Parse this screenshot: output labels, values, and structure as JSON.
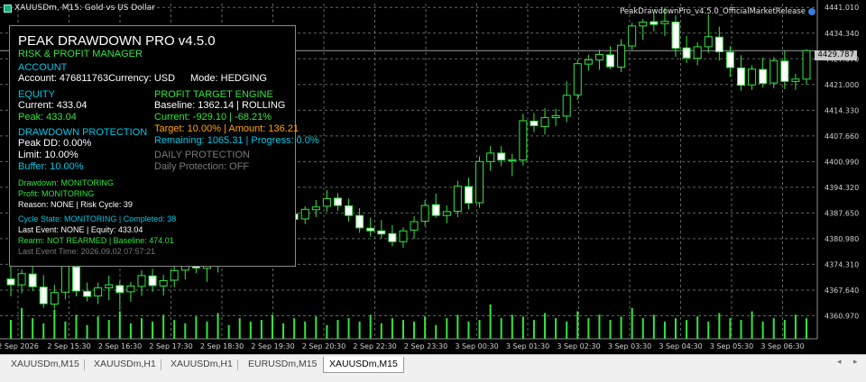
{
  "window": {
    "symbol_title": "XAUUSDm, M15:  Gold vs US Dollar",
    "ea_label": "PeakDrawdownPro_v4.5.0_OfficialMarketRelease"
  },
  "panel": {
    "title": "PEAK DRAWDOWN PRO v4.5.0",
    "subtitle": "RISK & PROFIT MANAGER",
    "account_header": "ACCOUNT",
    "account_line": "Account: 476811763Currency: USD",
    "mode_line": "Mode: HEDGING",
    "equity_header": "EQUITY",
    "equity_current": "Current: 433.04",
    "equity_peak": "Peak: 433.04",
    "profit_header": "PROFIT TARGET ENGINE",
    "profit_baseline": "Baseline: 1362.14 | ROLLING",
    "profit_current": "Current: -929.10 | -68.21%",
    "profit_target": "Target: 10.00% | Amount: 136.21",
    "profit_remaining": "Remaining: 1065.31 | Progress: 0.0%",
    "drawdown_header": "DRAWDOWN PROTECTION",
    "peak_dd": "Peak DD: 0.00%",
    "dd_limit": "Limit: 10.00%",
    "dd_buffer": "Buffer: 10.00%",
    "daily_header": "DAILY PROTECTION",
    "daily_status": "Daily Protection: OFF",
    "status_drawdown": "Drawdown: MONITORING",
    "status_profit": "Profit: MONITORING",
    "status_reason": "Reason: NONE  |  Risk Cycle: 39",
    "cycle_state": "Cycle State: MONITORING | Completed: 38",
    "last_event": "Last Event: NONE | Equity: 433.04",
    "rearm": "Rearm: NOT REARMED | Baseline: 474.01",
    "last_event_time": "Last Event Time: 2026.09.02 07:57:21"
  },
  "price_axis": {
    "labels": [
      "4441.010",
      "4434.340",
      "4427.670",
      "4421.000",
      "4414.330",
      "4407.660",
      "4400.990",
      "4394.320",
      "4387.650",
      "4380.980",
      "4374.310",
      "4367.640",
      "4360.970"
    ],
    "current_price": "4429.787"
  },
  "time_axis": {
    "labels": [
      "2 Sep 2026",
      "2 Sep 15:30",
      "2 Sep 16:30",
      "2 Sep 17:30",
      "2 Sep 18:30",
      "2 Sep 19:30",
      "2 Sep 20:30",
      "2 Sep 22:30",
      "2 Sep 23:30",
      "3 Sep 00:30",
      "3 Sep 01:30",
      "3 Sep 02:30",
      "3 Sep 03:30",
      "3 Sep 04:30",
      "3 Sep 05:30",
      "3 Sep 06:30"
    ]
  },
  "chart_data": {
    "type": "candlestick",
    "symbol": "XAUUSDm",
    "timeframe": "M15",
    "ylim": [
      4355,
      4442
    ],
    "grid": true,
    "candles": [
      [
        4370.5,
        4374.6,
        4366.0,
        4369.0
      ],
      [
        4369.0,
        4373.0,
        4366.8,
        4371.9
      ],
      [
        4371.8,
        4375.0,
        4367.4,
        4368.5
      ],
      [
        4368.4,
        4371.5,
        4363.0,
        4364.1
      ],
      [
        4364.0,
        4369.0,
        4362.8,
        4367.0
      ],
      [
        4367.1,
        4375.6,
        4365.2,
        4373.8
      ],
      [
        4373.6,
        4375.2,
        4366.0,
        4367.4
      ],
      [
        4367.3,
        4369.6,
        4364.7,
        4366.0
      ],
      [
        4366.1,
        4369.6,
        4364.0,
        4368.2
      ],
      [
        4368.2,
        4371.4,
        4365.0,
        4369.0
      ],
      [
        4368.8,
        4370.0,
        4362.4,
        4367.0
      ],
      [
        4367.2,
        4369.8,
        4364.6,
        4368.7
      ],
      [
        4368.6,
        4372.8,
        4366.1,
        4371.4
      ],
      [
        4371.3,
        4373.2,
        4367.2,
        4368.8
      ],
      [
        4368.7,
        4371.6,
        4366.2,
        4370.1
      ],
      [
        4370.2,
        4374.5,
        4368.4,
        4372.7
      ],
      [
        4372.8,
        4376.5,
        4370.4,
        4375.2
      ],
      [
        4375.0,
        4377.7,
        4372.0,
        4373.4
      ],
      [
        4373.3,
        4375.3,
        4369.8,
        4374.0
      ],
      [
        4374.0,
        4378.2,
        4372.2,
        4376.4
      ],
      [
        4376.5,
        4380.0,
        4374.3,
        4378.8
      ],
      [
        4378.7,
        4382.3,
        4376.5,
        4380.6
      ],
      [
        4380.4,
        4384.4,
        4378.0,
        4382.0
      ],
      [
        4381.9,
        4386.0,
        4380.0,
        4384.1
      ],
      [
        4384.0,
        4388.2,
        4382.5,
        4386.2
      ],
      [
        4386.1,
        4390.0,
        4384.0,
        4387.3
      ],
      [
        4387.4,
        4389.5,
        4384.4,
        4386.0
      ],
      [
        4386.1,
        4389.4,
        4384.8,
        4388.6
      ],
      [
        4388.5,
        4391.0,
        4386.6,
        4389.2
      ],
      [
        4389.4,
        4393.6,
        4388.0,
        4391.4
      ],
      [
        4391.5,
        4392.8,
        4388.2,
        4389.6
      ],
      [
        4389.5,
        4391.4,
        4385.4,
        4387.0
      ],
      [
        4387.0,
        4388.9,
        4382.5,
        4383.8
      ],
      [
        4383.7,
        4386.4,
        4381.5,
        4383.0
      ],
      [
        4383.0,
        4385.8,
        4381.0,
        4382.2
      ],
      [
        4382.3,
        4384.5,
        4379.0,
        4380.2
      ],
      [
        4380.2,
        4383.9,
        4378.6,
        4383.0
      ],
      [
        4383.2,
        4386.8,
        4381.0,
        4385.4
      ],
      [
        4385.5,
        4391.0,
        4384.3,
        4389.6
      ],
      [
        4389.8,
        4392.7,
        4386.4,
        4387.0
      ],
      [
        4387.0,
        4389.6,
        4385.0,
        4388.0
      ],
      [
        4388.1,
        4396.0,
        4386.6,
        4394.6
      ],
      [
        4394.5,
        4396.8,
        4388.6,
        4390.2
      ],
      [
        4390.3,
        4402.4,
        4389.0,
        4401.0
      ],
      [
        4401.0,
        4405.0,
        4398.6,
        4403.2
      ],
      [
        4403.2,
        4405.0,
        4399.8,
        4401.4
      ],
      [
        4401.2,
        4403.0,
        4397.2,
        4401.5
      ],
      [
        4401.4,
        4413.4,
        4400.0,
        4411.6
      ],
      [
        4411.5,
        4413.6,
        4408.6,
        4410.3
      ],
      [
        4410.1,
        4414.9,
        4408.0,
        4412.4
      ],
      [
        4412.4,
        4414.7,
        4410.2,
        4412.9
      ],
      [
        4412.8,
        4421.8,
        4411.2,
        4418.2
      ],
      [
        4418.3,
        4427.4,
        4417.0,
        4426.4
      ],
      [
        4426.3,
        4428.7,
        4424.6,
        4427.4
      ],
      [
        4427.4,
        4430.0,
        4424.8,
        4428.8
      ],
      [
        4428.7,
        4430.9,
        4425.0,
        4425.6
      ],
      [
        4425.5,
        4432.8,
        4424.2,
        4431.2
      ],
      [
        4431.0,
        4437.0,
        4430.0,
        4436.2
      ],
      [
        4436.2,
        4438.0,
        4432.6,
        4437.2
      ],
      [
        4437.3,
        4439.5,
        4434.8,
        4436.6
      ],
      [
        4436.8,
        4441.0,
        4433.6,
        4437.4
      ],
      [
        4437.2,
        4438.9,
        4428.2,
        4430.4
      ],
      [
        4430.5,
        4433.6,
        4426.6,
        4427.9
      ],
      [
        4427.8,
        4432.0,
        4426.0,
        4430.8
      ],
      [
        4430.8,
        4439.2,
        4429.2,
        4433.4
      ],
      [
        4433.3,
        4436.0,
        4427.2,
        4429.5
      ],
      [
        4429.4,
        4431.0,
        4423.0,
        4425.4
      ],
      [
        4425.3,
        4428.6,
        4419.4,
        4420.8
      ],
      [
        4420.9,
        4426.0,
        4419.6,
        4425.0
      ],
      [
        4424.9,
        4428.0,
        4420.2,
        4421.3
      ],
      [
        4421.4,
        4428.1,
        4420.0,
        4427.2
      ],
      [
        4427.1,
        4429.8,
        4419.8,
        4421.8
      ],
      [
        4421.8,
        4423.8,
        4419.6,
        4422.4
      ],
      [
        4422.4,
        4430.2,
        4421.0,
        4429.8
      ]
    ]
  },
  "volume": [
    0.55,
    0.9,
    0.6,
    0.45,
    0.85,
    0.5,
    0.7,
    0.4,
    0.65,
    0.55,
    0.8,
    0.45,
    0.6,
    0.5,
    0.7,
    0.55,
    0.45,
    0.65,
    0.5,
    0.75,
    0.4,
    0.6,
    0.5,
    0.55,
    0.7,
    0.45,
    0.6,
    0.5,
    0.65,
    0.4,
    0.55,
    0.6,
    0.5,
    0.7,
    0.45,
    0.6,
    0.55,
    0.5,
    0.65,
    0.4,
    0.6,
    0.7,
    0.5,
    0.55,
    1.0,
    0.6,
    0.7,
    0.65,
    0.55,
    0.75,
    0.6,
    0.5,
    0.8,
    0.6,
    0.7,
    0.55,
    0.65,
    0.9,
    0.6,
    0.7,
    0.5,
    0.6,
    0.55,
    0.65,
    0.5,
    0.75,
    0.6,
    0.55,
    0.8,
    0.5,
    0.6,
    0.55,
    0.7,
    0.6
  ],
  "tabs": [
    "XAUUSDm,M15",
    "XAUUSDm,H1",
    "XAUUSDm,H1",
    "EURUSDm,M15",
    "XAUUSDm,M15"
  ],
  "colors": {
    "bull_outline": "#33e640",
    "bear_fill": "#ffffff",
    "grid": "#5a6a5a",
    "axis_text": "#d0d0d0",
    "background": "#000000"
  }
}
